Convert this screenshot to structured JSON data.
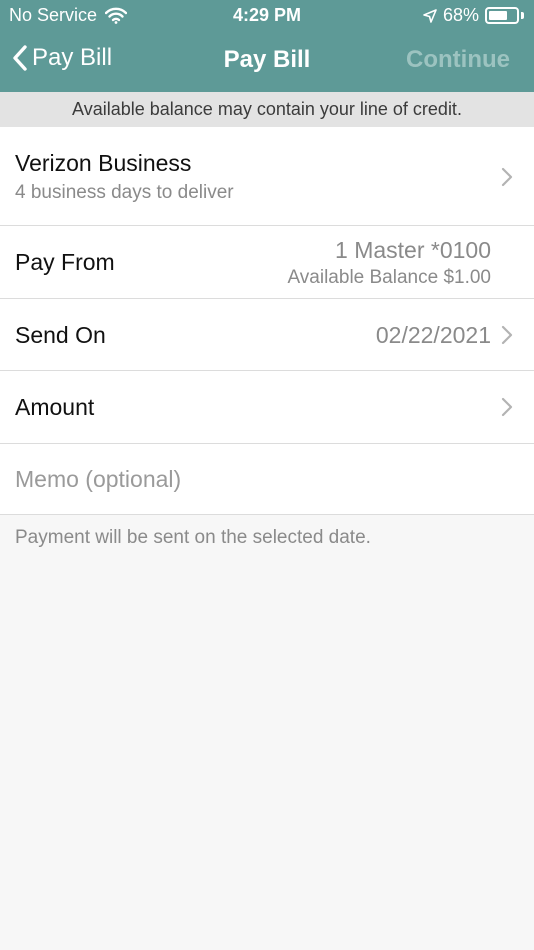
{
  "status_bar": {
    "carrier": "No Service",
    "time": "4:29 PM",
    "battery": "68%",
    "battery_level": 0.68
  },
  "nav": {
    "back_label": "Pay Bill",
    "title": "Pay Bill",
    "continue_label": "Continue"
  },
  "banner": "Available balance may contain your line of credit.",
  "payee": {
    "name": "Verizon Business",
    "delivery": "4 business days to deliver"
  },
  "pay_from": {
    "label": "Pay From",
    "account": "1 Master *0100",
    "balance": "Available Balance $1.00"
  },
  "send_on": {
    "label": "Send On",
    "date": "02/22/2021"
  },
  "amount": {
    "label": "Amount"
  },
  "memo": {
    "placeholder": "Memo (optional)"
  },
  "footer_note": "Payment will be sent on the selected date.",
  "colors": {
    "header": "#5e9a97",
    "continue_disabled": "#9cc3c0",
    "banner": "#e3e3e3"
  }
}
